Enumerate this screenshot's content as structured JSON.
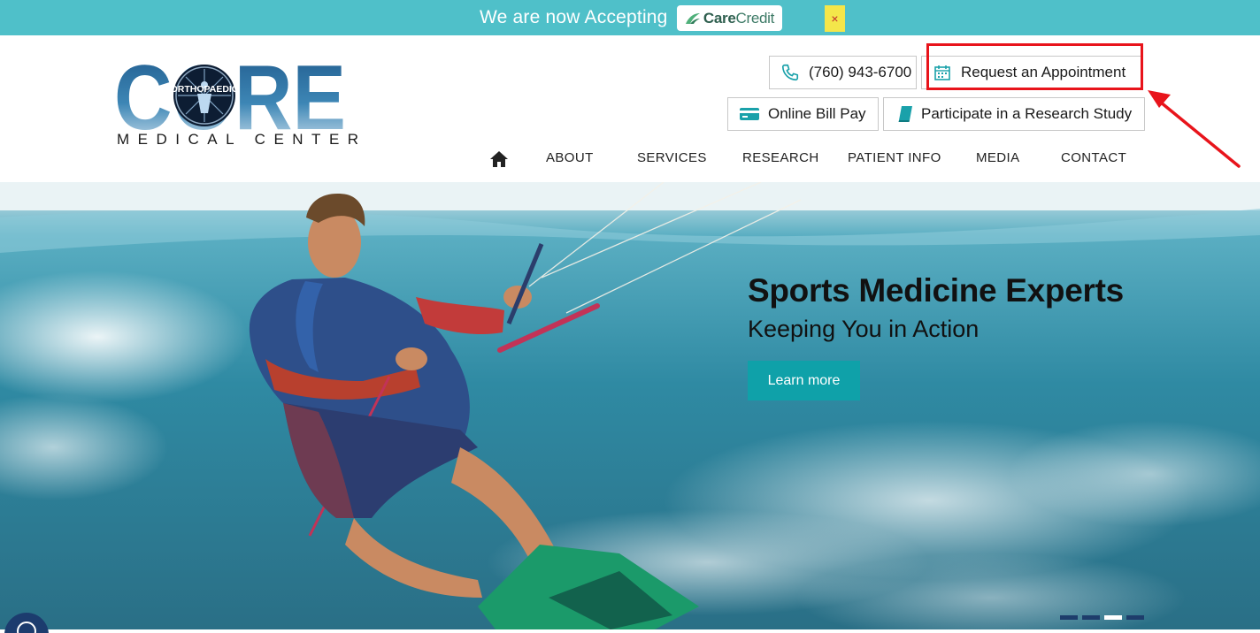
{
  "banner": {
    "text": "We are now Accepting",
    "brand_care": "Care",
    "brand_credit": "Credit",
    "close_label": "×",
    "bg_color": "#4fc0c9"
  },
  "logo": {
    "wordmark": "CORE",
    "badge": "ORTHOPAEDIC",
    "subtitle": "MEDICAL CENTER"
  },
  "header_buttons": {
    "phone": "(760) 943-6700",
    "appointment": "Request an Appointment",
    "bill_pay": "Online Bill Pay",
    "research": "Participate in a Research Study"
  },
  "nav": {
    "items": [
      "ABOUT",
      "SERVICES",
      "RESEARCH",
      "PATIENT INFO",
      "MEDIA",
      "CONTACT"
    ]
  },
  "hero": {
    "title": "Sports Medicine Experts",
    "subtitle": "Keeping You in Action",
    "cta": "Learn more",
    "slides_total": 4,
    "active_slide": 3
  },
  "colors": {
    "accent": "#0fa1a9",
    "highlight": "#e8141b",
    "dark_blue": "#1e3d6b"
  }
}
